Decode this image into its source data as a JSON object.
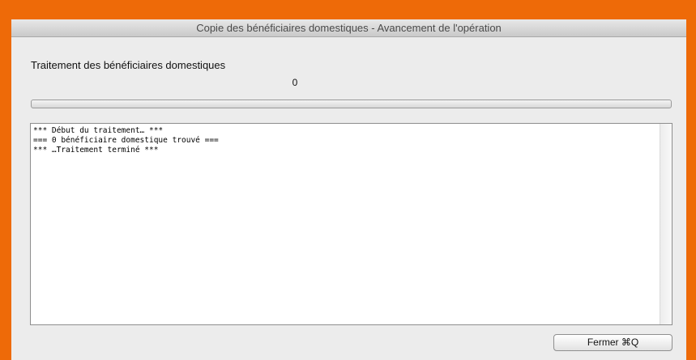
{
  "window": {
    "title": "Copie des bénéficiaires domestiques - Avancement de l'opération"
  },
  "main": {
    "heading": "Traitement des bénéficiaires domestiques",
    "count": "0",
    "progress_fraction": 0
  },
  "log": {
    "lines": [
      "*** Début du traitement… ***",
      "=== 0 bénéficiaire domestique trouvé ===",
      "*** …Traitement terminé ***"
    ]
  },
  "footer": {
    "close_label": "Fermer ⌘Q"
  },
  "colors": {
    "background": "#EE6A08",
    "window": "#ECECEC"
  }
}
